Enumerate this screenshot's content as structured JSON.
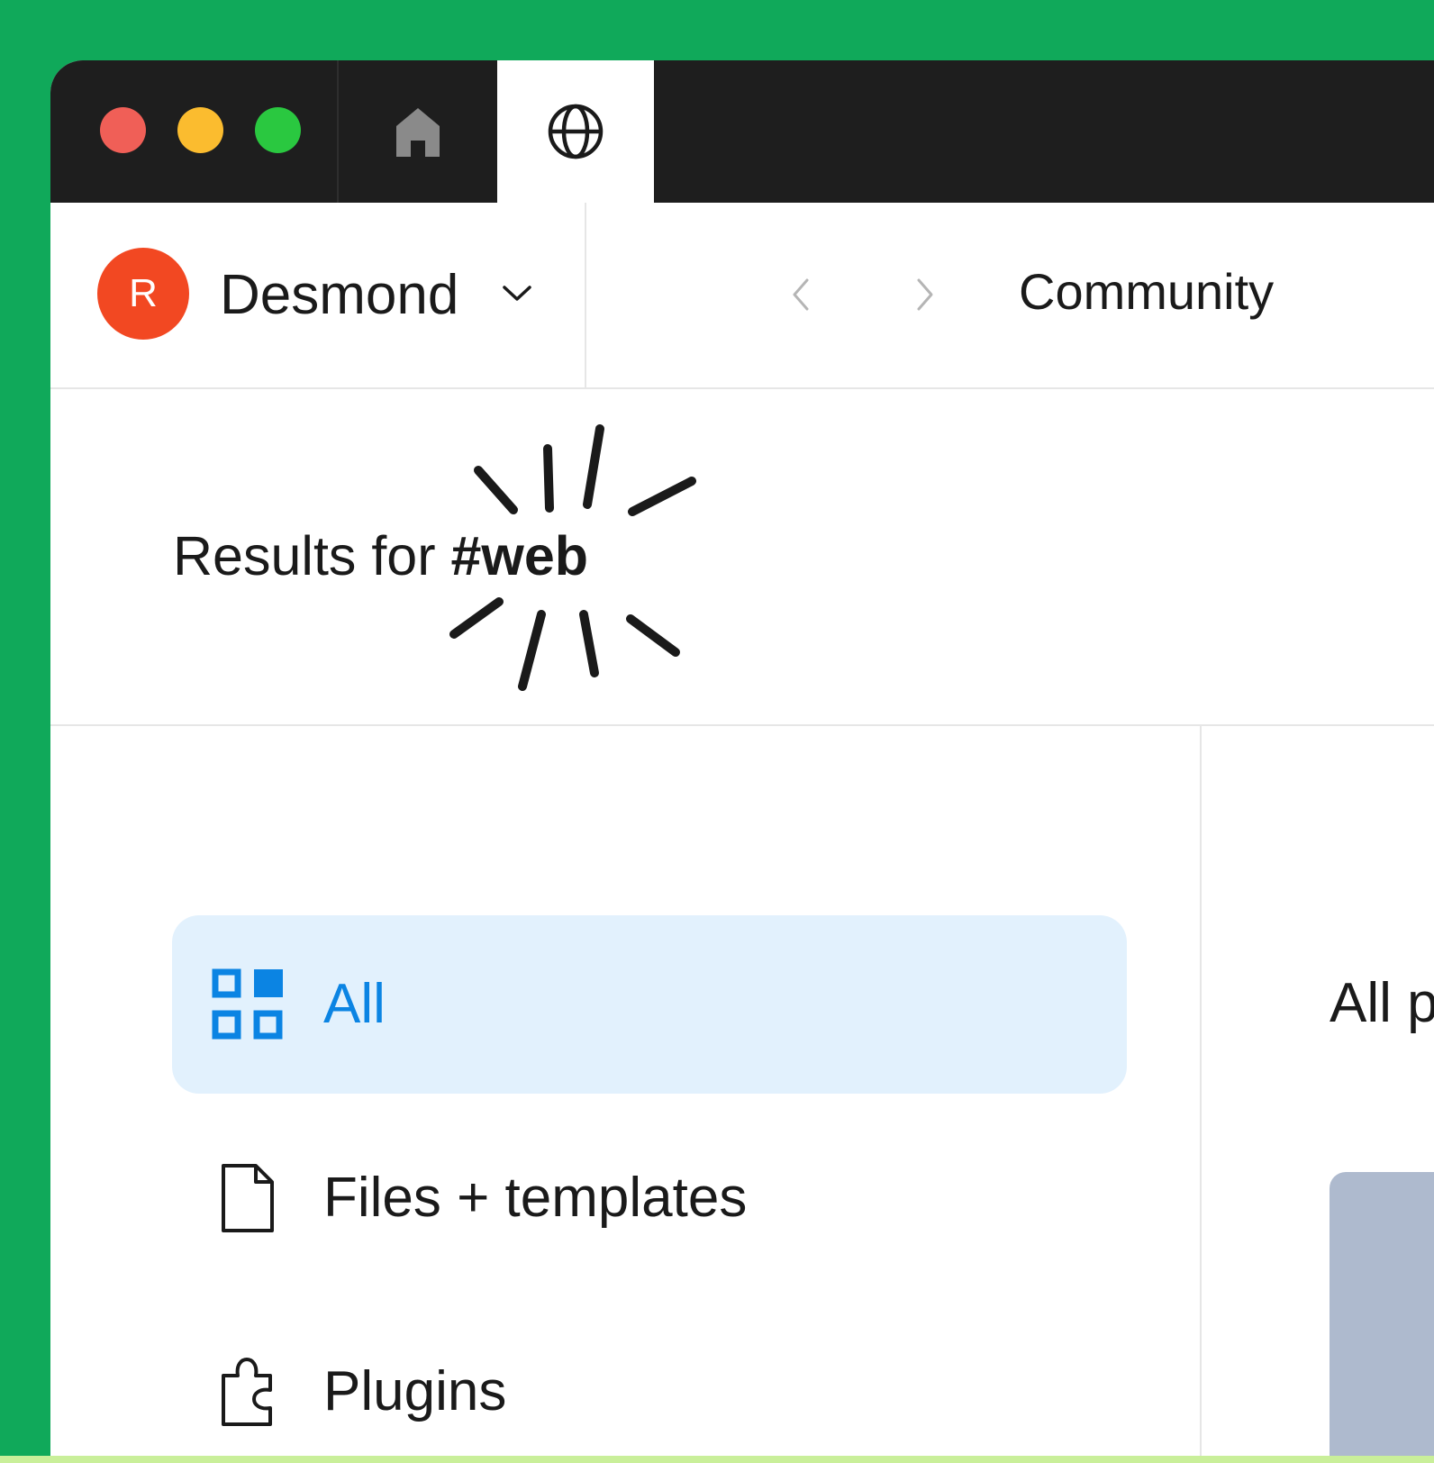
{
  "window": {
    "traffic_lights": [
      "close",
      "minimize",
      "maximize"
    ],
    "tabs": [
      {
        "icon": "home-icon"
      },
      {
        "icon": "globe-icon",
        "active": true
      }
    ]
  },
  "header": {
    "avatar_initial": "R",
    "user_name": "Desmond",
    "page_title": "Community"
  },
  "results": {
    "prefix": "Results for ",
    "tag": "#web"
  },
  "sidebar": {
    "items": [
      {
        "label": "All",
        "icon": "grid-icon",
        "active": true
      },
      {
        "label": "Files + templates",
        "icon": "file-icon",
        "active": false
      },
      {
        "label": "Plugins",
        "icon": "plugin-icon",
        "active": false
      }
    ]
  },
  "main": {
    "heading": "All p"
  },
  "colors": {
    "background_green": "#10a95a",
    "accent_blue": "#0b84e3",
    "active_bg": "#e2f1fd",
    "avatar": "#f24822"
  }
}
